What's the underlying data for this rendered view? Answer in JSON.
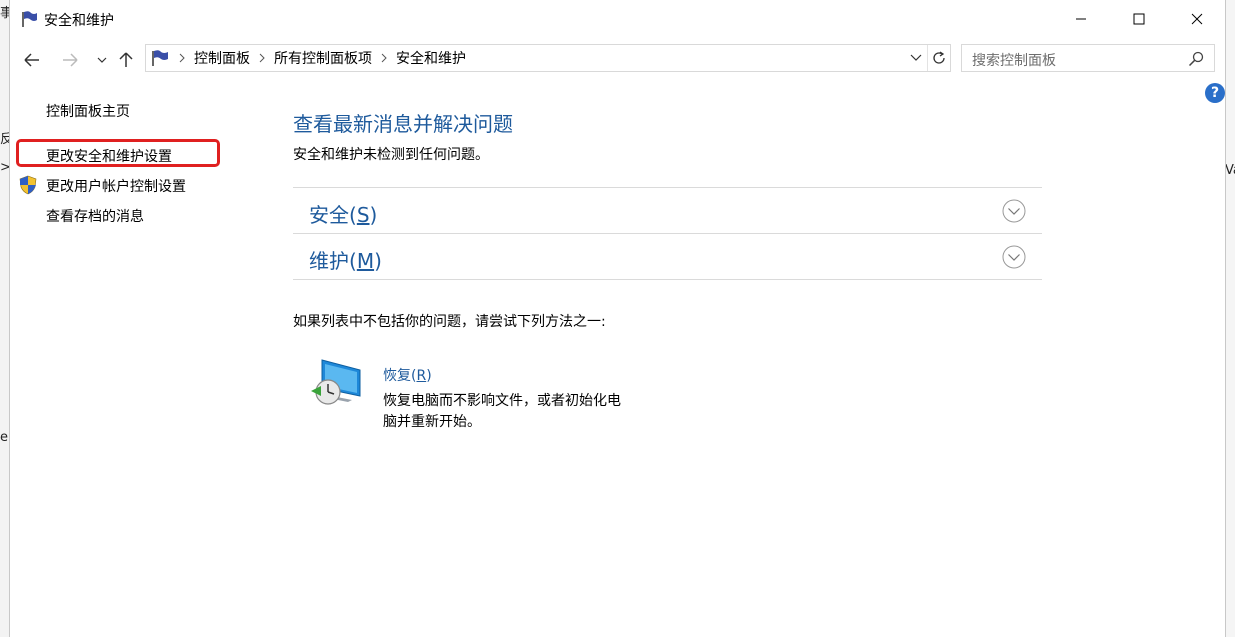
{
  "window": {
    "title": "安全和维护",
    "minimize": "minimize",
    "maximize": "maximize",
    "close": "close"
  },
  "background": {
    "glyphs": [
      "事",
      "反",
      ">",
      "e"
    ],
    "right_glyph": "Va"
  },
  "address_bar": {
    "crumbs": [
      "控制面板",
      "所有控制面板项",
      "安全和维护"
    ]
  },
  "search": {
    "placeholder": "搜索控制面板"
  },
  "help": {
    "label": "?"
  },
  "sidebar": {
    "items": [
      {
        "label": "控制面板主页"
      },
      {
        "label": "更改安全和维护设置",
        "highlighted": true
      },
      {
        "label": "更改用户帐户控制设置",
        "icon": "uac-shield-icon"
      },
      {
        "label": "查看存档的消息"
      }
    ]
  },
  "main": {
    "title": "查看最新消息并解决问题",
    "subtitle": "安全和维护未检测到任何问题。",
    "sections": [
      {
        "label_main": "安全(",
        "label_key": "S",
        "label_end": ")"
      },
      {
        "label_main": "维护(",
        "label_key": "M",
        "label_end": ")"
      }
    ],
    "alt_prompt": "如果列表中不包括你的问题，请尝试下列方法之一:",
    "recovery": {
      "link_main": "恢复(",
      "link_key": "R",
      "link_end": ")",
      "description": "恢复电脑而不影响文件，或者初始化电脑并重新开始。"
    }
  },
  "colors": {
    "link": "#1e5a9c",
    "highlight": "#e02020",
    "help": "#2a6fc9"
  }
}
